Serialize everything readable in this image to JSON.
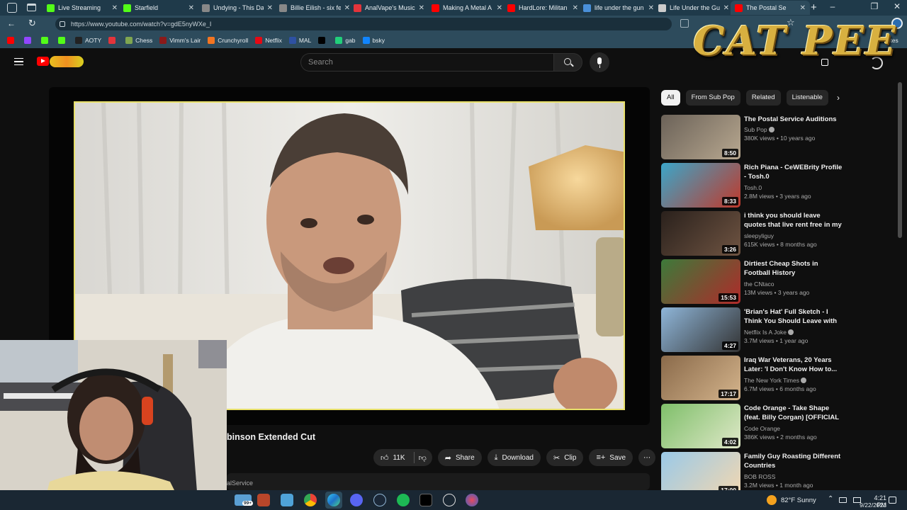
{
  "browser": {
    "tabs": [
      {
        "label": "Live Streaming",
        "color": "#53fc18"
      },
      {
        "label": "Starfield",
        "color": "#53fc18"
      },
      {
        "label": "Undying - This Da",
        "color": "#888888"
      },
      {
        "label": "Billie Eilish - six fe",
        "color": "#888888"
      },
      {
        "label": "AnalVape's Music",
        "color": "#e3343b"
      },
      {
        "label": "Making A Metal A",
        "color": "#ff0000"
      },
      {
        "label": "HardLore: Militan",
        "color": "#ff0000"
      },
      {
        "label": "life under the gun",
        "color": "#4a90d9"
      },
      {
        "label": "Life Under the Gu",
        "color": "#cccccc"
      },
      {
        "label": "The Postal Se",
        "color": "#ff0000"
      }
    ],
    "url": "https://www.youtube.com/watch?v=gdE5nyWXe_I",
    "bookmarks": [
      {
        "label": "",
        "color": "#ff0000"
      },
      {
        "label": "",
        "color": "#9146ff"
      },
      {
        "label": "",
        "color": "#53fc18"
      },
      {
        "label": "",
        "color": "#53fc18"
      },
      {
        "label": "AOTY",
        "color": "#222222"
      },
      {
        "label": "",
        "color": "#e3343b"
      },
      {
        "label": "Chess",
        "color": "#7fa650"
      },
      {
        "label": "Vimm's Lair",
        "color": "#8b1a1a"
      },
      {
        "label": "Crunchyroll",
        "color": "#f47521"
      },
      {
        "label": "Netflix",
        "color": "#e50914"
      },
      {
        "label": "MAL",
        "color": "#2e51a2"
      },
      {
        "label": "",
        "color": "#000000"
      },
      {
        "label": "gab",
        "color": "#21cf7a"
      },
      {
        "label": "bsky",
        "color": "#1185fe"
      }
    ],
    "favorites_label": "orites"
  },
  "overlay_text": "CAT PEE",
  "youtube": {
    "search_placeholder": "Search",
    "video_title": "binson Extended Cut",
    "channel_partial": "alService",
    "actions": {
      "likes": "11K",
      "share": "Share",
      "download": "Download",
      "clip": "Clip",
      "save": "Save"
    },
    "chips": [
      "All",
      "From Sub Pop",
      "Related",
      "Listenable"
    ],
    "recommendations": [
      {
        "title": "The Postal Service Auditions",
        "channel": "Sub Pop",
        "verified": true,
        "meta": "380K views • 10 years ago",
        "duration": "8:50",
        "thumb": [
          "#6b6258",
          "#b8a890"
        ]
      },
      {
        "title": "Rich Piana - CeWEBrity Profile - Tosh.0",
        "channel": "Tosh.0",
        "verified": false,
        "meta": "2.8M views • 3 years ago",
        "duration": "8:33",
        "thumb": [
          "#3ba6c9",
          "#c0392b"
        ]
      },
      {
        "title": "i think you should leave quotes that live rent free in my brain...",
        "channel": "sleepyliguy",
        "verified": false,
        "meta": "615K views • 8 months ago",
        "duration": "3:26",
        "thumb": [
          "#2a211c",
          "#6f5442"
        ]
      },
      {
        "title": "Dirtiest Cheap Shots in Football History",
        "channel": "the CNtaco",
        "verified": false,
        "meta": "13M views • 3 years ago",
        "duration": "15:53",
        "thumb": [
          "#3c7a3a",
          "#b02a2a"
        ]
      },
      {
        "title": "'Brian's Hat' Full Sketch - I Think You Should Leave with Tim...",
        "channel": "Netflix Is A Joke",
        "verified": true,
        "meta": "3.7M views • 1 year ago",
        "duration": "4:27",
        "thumb": [
          "#8fb6d9",
          "#333333"
        ]
      },
      {
        "title": "Iraq War Veterans, 20 Years Later: 'I Don't Know How to...",
        "channel": "The New York Times",
        "verified": true,
        "meta": "6.7M views • 6 months ago",
        "duration": "17:17",
        "thumb": [
          "#8a6a4a",
          "#d4b48c"
        ]
      },
      {
        "title": "Code Orange - Take Shape (feat. Billy Corgan) [OFFICIAL VIDEO]",
        "channel": "Code Orange",
        "verified": false,
        "meta": "386K views • 2 months ago",
        "duration": "4:02",
        "thumb": [
          "#7fbf6a",
          "#dfe8c8"
        ]
      },
      {
        "title": "Family Guy Roasting Different Countries",
        "channel": "BOB ROSS",
        "verified": false,
        "meta": "3.2M views • 1 month ago",
        "duration": "17:00",
        "thumb": [
          "#9ac9e8",
          "#f2d7b0"
        ]
      }
    ]
  },
  "taskbar": {
    "notification_badge": "99+",
    "weather": "82°F  Sunny",
    "time": "4:21 PM",
    "date": "9/22/2023"
  }
}
